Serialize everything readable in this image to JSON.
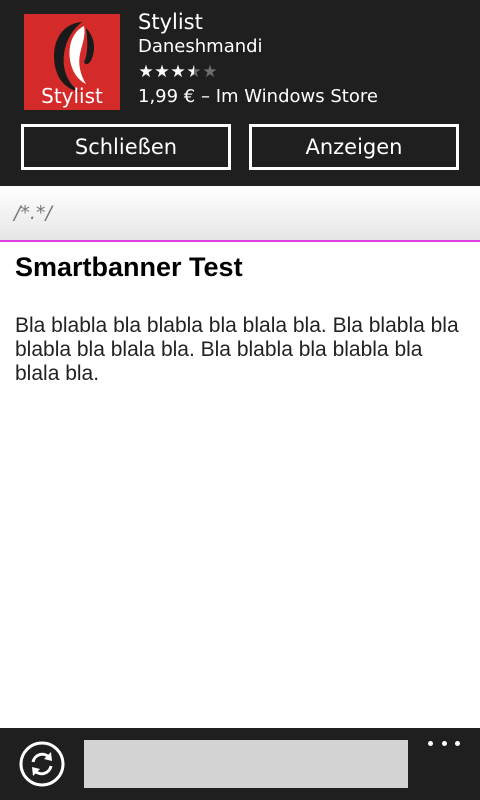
{
  "banner": {
    "app_icon_label": "Stylist",
    "app_title": "Stylist",
    "developer": "Daneshmandi",
    "rating": 3.5,
    "rating_max": 5,
    "price_store": "1,99 € – Im Windows Store",
    "close_label": "Schließen",
    "view_label": "Anzeigen",
    "icon_background": "#d42a2a"
  },
  "header": {
    "text": "/*.*/",
    "accent_line_color": "#e040e0"
  },
  "content": {
    "title": "Smartbanner Test",
    "body": "Bla blabla bla blabla bla blala bla. Bla blabla bla blabla bla blala bla. Bla blabla bla blabla bla blala bla."
  },
  "bottom_bar": {
    "refresh_icon": "refresh-icon",
    "address_value": "",
    "more_icon": "more-icon"
  }
}
